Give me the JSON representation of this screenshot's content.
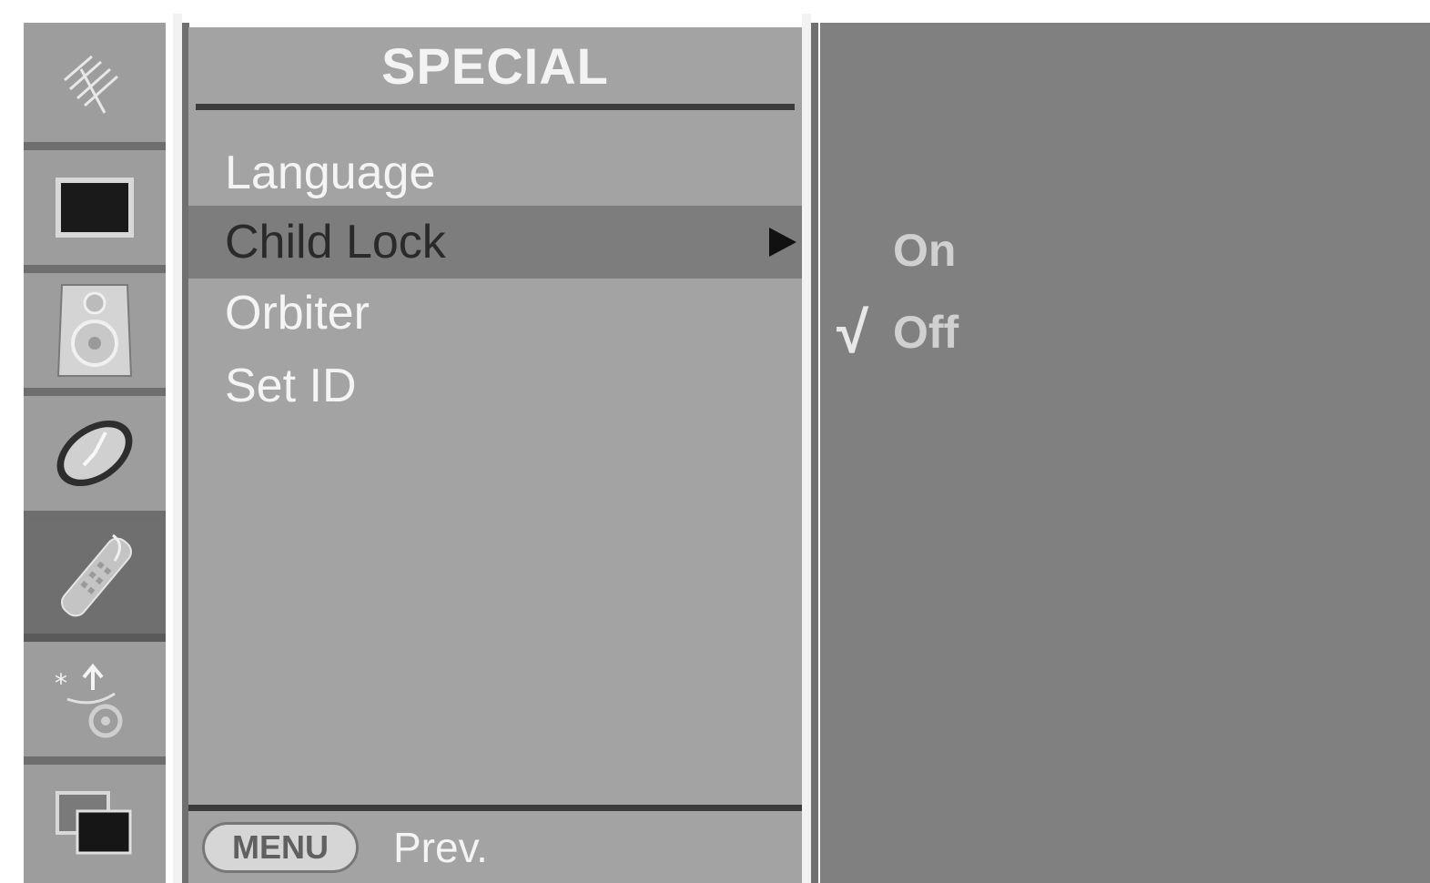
{
  "sidebar": {
    "icons": [
      {
        "name": "antenna-icon"
      },
      {
        "name": "picture-icon"
      },
      {
        "name": "speaker-icon"
      },
      {
        "name": "clock-icon"
      },
      {
        "name": "remote-control-icon",
        "active": true
      },
      {
        "name": "screen-adjust-icon"
      },
      {
        "name": "pip-icon"
      }
    ]
  },
  "menu": {
    "title": "SPECIAL",
    "items": [
      {
        "label": "Language"
      },
      {
        "label": "Child Lock",
        "selected": true
      },
      {
        "label": "Orbiter"
      },
      {
        "label": "Set ID"
      }
    ],
    "footer": {
      "button_label": "MENU",
      "label": "Prev."
    }
  },
  "submenu": {
    "options": [
      {
        "label": "On",
        "checked": false
      },
      {
        "label": "Off",
        "checked": true
      }
    ],
    "check_mark": "√"
  },
  "colors": {
    "menu_bg": "#a3a3a3",
    "submenu_bg": "#808080",
    "selected_row": "#7d7d7d",
    "text": "#f4f4f4"
  }
}
